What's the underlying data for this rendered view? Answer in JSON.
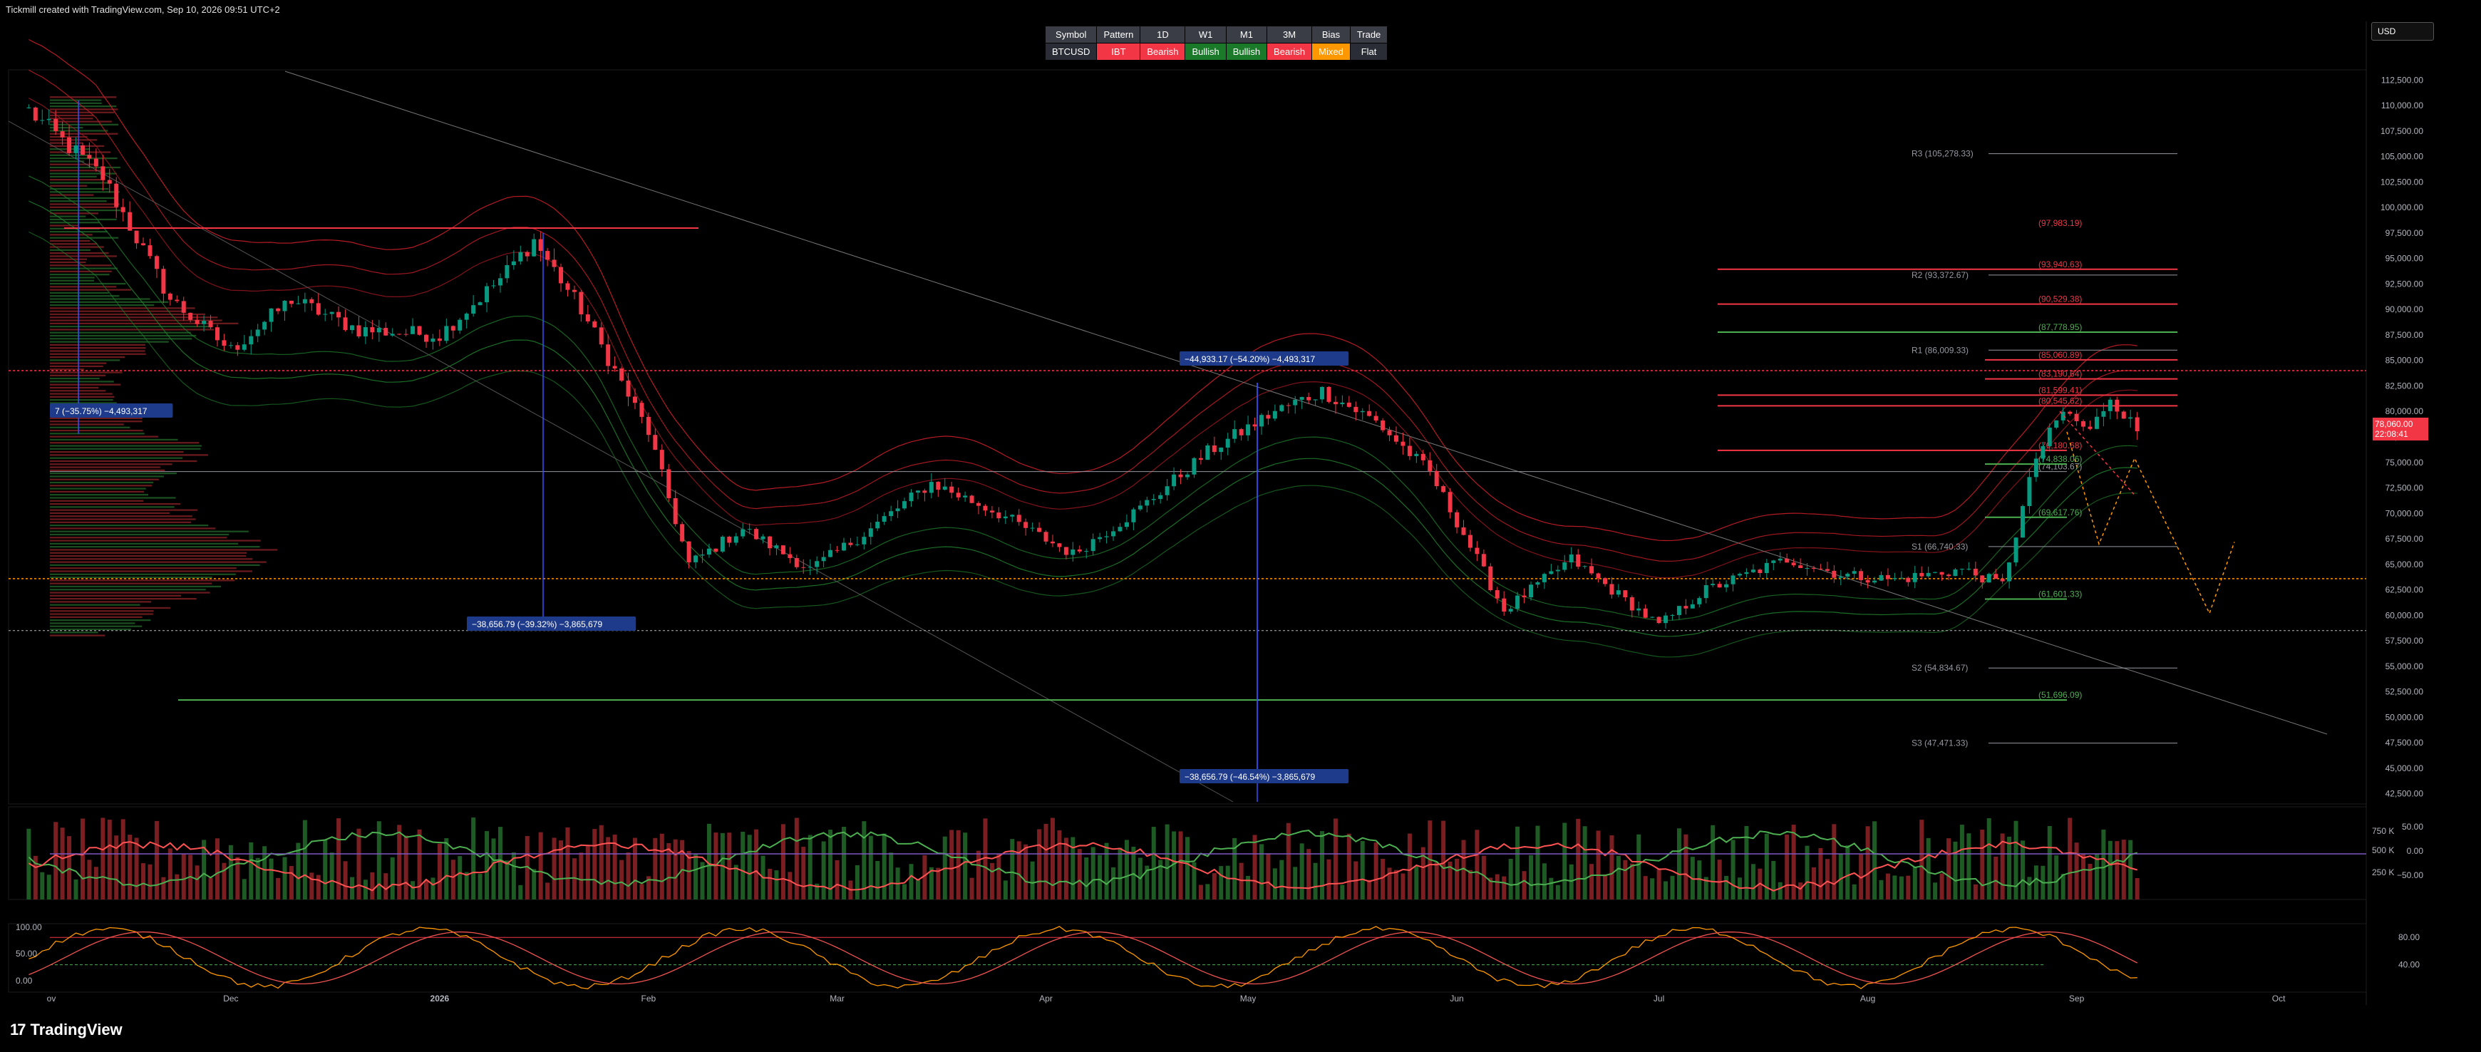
{
  "header": {
    "attribution": "Tickmill created with TradingView.com, Sep 10, 2026 09:51 UTC+2"
  },
  "currency_selector": {
    "value": "USD"
  },
  "brand": {
    "logo": "17",
    "name": "TradingView"
  },
  "colors": {
    "bull": "#089981",
    "bear": "#f23645",
    "mixed": "#ff9800",
    "label_bg": "#1e3a8a"
  },
  "summary_table": {
    "headers": [
      "Symbol",
      "Pattern",
      "1D",
      "W1",
      "M1",
      "3M",
      "Bias",
      "Trade"
    ],
    "row": [
      {
        "text": "BTCUSD",
        "tone": "neutral"
      },
      {
        "text": "IBT",
        "tone": "bear"
      },
      {
        "text": "Bearish",
        "tone": "bear"
      },
      {
        "text": "Bullish",
        "tone": "bull"
      },
      {
        "text": "Bullish",
        "tone": "bull"
      },
      {
        "text": "Bearish",
        "tone": "bear"
      },
      {
        "text": "Mixed",
        "tone": "mixed"
      },
      {
        "text": "Flat",
        "tone": "neutral"
      }
    ]
  },
  "current_price": {
    "value": "78,060.00",
    "countdown": "22:08:41"
  },
  "chart_data": [
    {
      "type": "candlestick",
      "symbol": "BTCUSD",
      "timeframe": "1D",
      "x_ticks": [
        "ov",
        "Dec",
        "2026",
        "Feb",
        "Mar",
        "Apr",
        "May",
        "Jun",
        "Jul",
        "Aug",
        "Sep",
        "Oct"
      ],
      "y_ticks": [
        "112,500.00",
        "110,000.00",
        "107,500.00",
        "105,000.00",
        "102,500.00",
        "100,000.00",
        "97,500.00",
        "95,000.00",
        "92,500.00",
        "90,000.00",
        "87,500.00",
        "85,000.00",
        "82,500.00",
        "80,000.00",
        "77,500.00",
        "75,000.00",
        "72,500.00",
        "70,000.00",
        "67,500.00",
        "65,000.00",
        "62,500.00",
        "60,000.00",
        "57,500.00",
        "55,000.00",
        "52,500.00",
        "50,000.00",
        "47,500.00",
        "45,000.00",
        "42,500.00"
      ],
      "ylim": [
        41500,
        113500
      ],
      "close_anchors": [
        {
          "date": "2025-11-01",
          "close": 109500
        },
        {
          "date": "2025-11-12",
          "close": 103000
        },
        {
          "date": "2025-11-22",
          "close": 91000
        },
        {
          "date": "2025-12-01",
          "close": 86000
        },
        {
          "date": "2025-12-10",
          "close": 91000
        },
        {
          "date": "2025-12-20",
          "close": 88000
        },
        {
          "date": "2026-01-01",
          "close": 87500
        },
        {
          "date": "2026-01-10",
          "close": 93000
        },
        {
          "date": "2026-01-15",
          "close": 96800
        },
        {
          "date": "2026-01-22",
          "close": 90000
        },
        {
          "date": "2026-02-01",
          "close": 78000
        },
        {
          "date": "2026-02-07",
          "close": 65000
        },
        {
          "date": "2026-02-15",
          "close": 68500
        },
        {
          "date": "2026-02-25",
          "close": 64500
        },
        {
          "date": "2026-03-05",
          "close": 68000
        },
        {
          "date": "2026-03-15",
          "close": 73000
        },
        {
          "date": "2026-03-25",
          "close": 70000
        },
        {
          "date": "2026-04-05",
          "close": 66000
        },
        {
          "date": "2026-04-15",
          "close": 70500
        },
        {
          "date": "2026-04-25",
          "close": 76000
        },
        {
          "date": "2026-05-05",
          "close": 80000
        },
        {
          "date": "2026-05-12",
          "close": 82000
        },
        {
          "date": "2026-05-20",
          "close": 79000
        },
        {
          "date": "2026-05-28",
          "close": 74000
        },
        {
          "date": "2026-06-02",
          "close": 68000
        },
        {
          "date": "2026-06-08",
          "close": 60500
        },
        {
          "date": "2026-06-18",
          "close": 65500
        },
        {
          "date": "2026-06-25",
          "close": 62000
        },
        {
          "date": "2026-07-01",
          "close": 59000
        },
        {
          "date": "2026-07-08",
          "close": 62500
        },
        {
          "date": "2026-07-20",
          "close": 65500
        },
        {
          "date": "2026-07-28",
          "close": 64000
        },
        {
          "date": "2026-08-05",
          "close": 63500
        },
        {
          "date": "2026-08-15",
          "close": 64500
        },
        {
          "date": "2026-08-21",
          "close": 63000
        },
        {
          "date": "2026-08-26",
          "close": 75500
        },
        {
          "date": "2026-08-30",
          "close": 80000
        },
        {
          "date": "2026-09-03",
          "close": 78000
        },
        {
          "date": "2026-09-06",
          "close": 81500
        },
        {
          "date": "2026-09-10",
          "close": 78060
        }
      ],
      "pivot_levels": [
        {
          "label": "R3 (105,278.33)",
          "value": 105278.33,
          "tone": "white"
        },
        {
          "label": "R2 (93,372.67)",
          "value": 93372.67,
          "tone": "white"
        },
        {
          "label": "R1 (86,009.33)",
          "value": 86009.33,
          "tone": "white"
        },
        {
          "label": "S1 (66,740.33)",
          "value": 66740.33,
          "tone": "white"
        },
        {
          "label": "S2 (54,834.67)",
          "value": 54834.67,
          "tone": "white"
        },
        {
          "label": "S3 (47,471.33)",
          "value": 47471.33,
          "tone": "white"
        }
      ],
      "marked_levels": [
        {
          "label": "(97,983.19)",
          "value": 97983.19,
          "tone": "red"
        },
        {
          "label": "(93,940.63)",
          "value": 93940.63,
          "tone": "red"
        },
        {
          "label": "(90,529.38)",
          "value": 90529.38,
          "tone": "red"
        },
        {
          "label": "(87,778.95)",
          "value": 87778.95,
          "tone": "green"
        },
        {
          "label": "(85,060.89)",
          "value": 85060.89,
          "tone": "red"
        },
        {
          "label": "(83,190.64)",
          "value": 83190.64,
          "tone": "red"
        },
        {
          "label": "(81,599.41)",
          "value": 81599.41,
          "tone": "red"
        },
        {
          "label": "(80,545.62)",
          "value": 80545.62,
          "tone": "red"
        },
        {
          "label": "(76,180.68)",
          "value": 76180.68,
          "tone": "red"
        },
        {
          "label": "(74,103.67)",
          "value": 74103.67,
          "tone": "white"
        },
        {
          "label": "(74,838.06)",
          "value": 74838.06,
          "tone": "green"
        },
        {
          "label": "(69,617.76)",
          "value": 69617.76,
          "tone": "green"
        },
        {
          "label": "(61,601.33)",
          "value": 61601.33,
          "tone": "green"
        },
        {
          "label": "(51,696.09)",
          "value": 51696.09,
          "tone": "green"
        }
      ],
      "measurements": [
        {
          "label": "7 (−35.75%) −4,493,317",
          "from": 110500,
          "to": 77800
        },
        {
          "label": "−38,656.79 (−39.32%) −3,865,679",
          "from": 97500,
          "to": 59700
        },
        {
          "label": "−44,933.17 (−54.20%) −4,493,317",
          "from": 82800,
          "to": 38000
        },
        {
          "label": "−38,656.79 (−46.54%) −3,865,679",
          "from": 82800,
          "to": 44200
        }
      ]
    },
    {
      "type": "bar",
      "name": "volume",
      "y_ticks": [
        "750 K",
        "500 K",
        "250 K"
      ],
      "osc_ticks": [
        "50.00",
        "0.00",
        "−50.00"
      ]
    },
    {
      "type": "line",
      "name": "oscillator",
      "left_ticks": [
        "100.00",
        "50.00",
        "0.00"
      ],
      "right_ticks": [
        "80.00",
        "40.00"
      ],
      "levels": [
        80,
        40
      ]
    }
  ]
}
